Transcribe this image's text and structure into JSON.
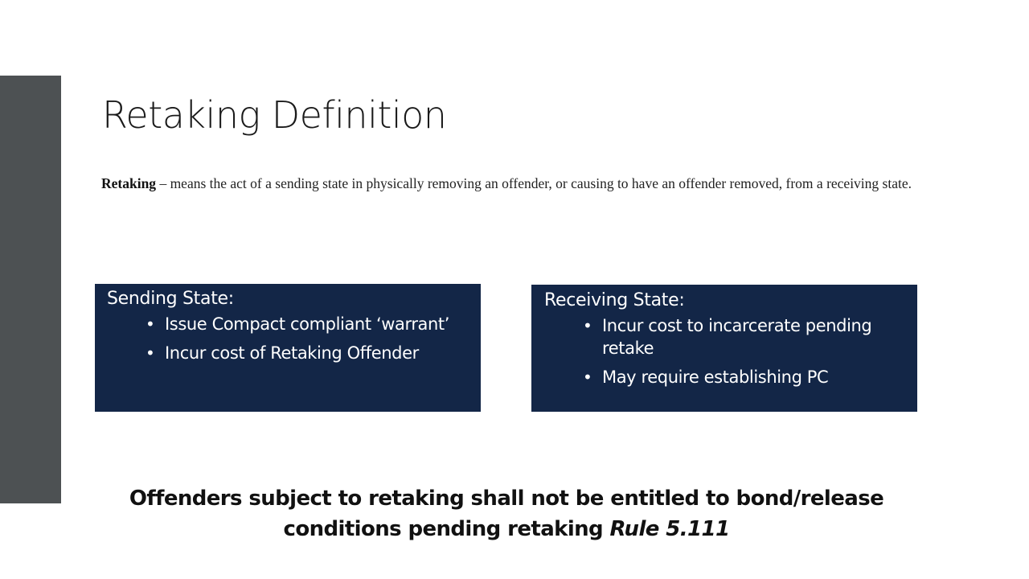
{
  "slide": {
    "title": "Retaking Definition",
    "definition": {
      "term": "Retaking",
      "text": " – means the act of a sending state in physically removing an offender, or causing to have an offender removed, from a receiving state."
    },
    "sending_box": {
      "heading": "Sending State:",
      "bullets": [
        "Issue Compact compliant ‘warrant’",
        "Incur cost of Retaking Offender"
      ]
    },
    "receiving_box": {
      "heading": "Receiving State:",
      "bullets": [
        "Incur cost to incarcerate pending retake",
        "May require establishing PC"
      ]
    },
    "bottom_note": {
      "text": "Offenders subject to retaking shall not be entitled to bond/release conditions pending retaking ",
      "rule": "Rule 5.111"
    },
    "bullet_glyph": "•",
    "colors": {
      "side_bar": "#4d5153",
      "box_background": "#132647",
      "box_text": "#ffffff"
    }
  }
}
